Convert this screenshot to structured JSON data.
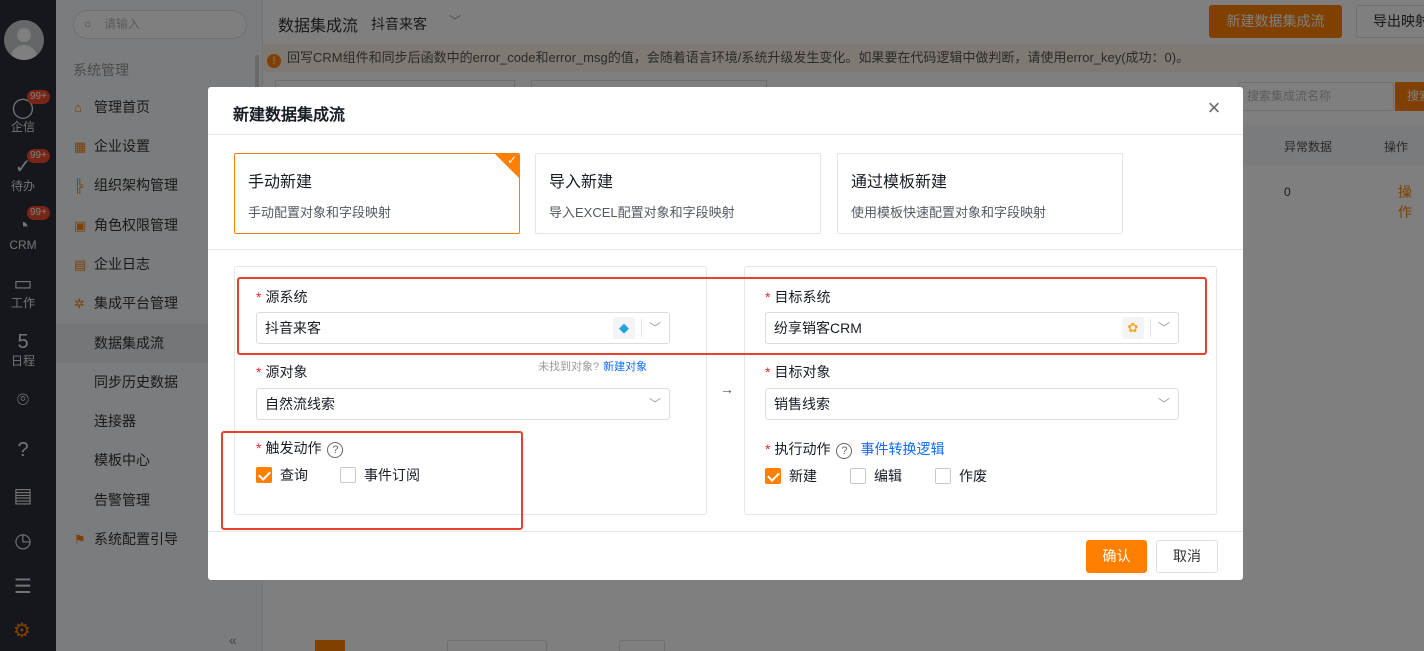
{
  "rail": {
    "items": [
      {
        "icon": "chat-icon",
        "label": "企信",
        "badge": "99+"
      },
      {
        "icon": "todo-icon",
        "label": "待办",
        "badge": "99+"
      },
      {
        "icon": "crm-icon",
        "label": "CRM",
        "badge": "99+"
      },
      {
        "icon": "work-icon",
        "label": "工作"
      },
      {
        "icon": "calendar-icon",
        "label": "日程",
        "glyph": "5"
      }
    ]
  },
  "menu": {
    "search_placeholder": "请输入",
    "group_title": "系统管理",
    "items": [
      {
        "label": "管理首页",
        "icon": "home-icon"
      },
      {
        "label": "企业设置",
        "icon": "enterprise-icon"
      },
      {
        "label": "组织架构管理",
        "icon": "org-icon"
      },
      {
        "label": "角色权限管理",
        "icon": "role-icon"
      },
      {
        "label": "企业日志",
        "icon": "log-icon"
      },
      {
        "label": "集成平台管理",
        "icon": "integration-icon"
      },
      {
        "label": "数据集成流"
      },
      {
        "label": "同步历史数据"
      },
      {
        "label": "连接器"
      },
      {
        "label": "模板中心"
      },
      {
        "label": "告警管理"
      },
      {
        "label": "系统配置引导",
        "icon": "guide-icon"
      }
    ],
    "collapse_glyph": "«"
  },
  "main": {
    "title": "数据集成流",
    "subtitle": "抖音来客",
    "new_flow_button": "新建数据集成流",
    "export_button": "导出映射",
    "notice": "回写CRM组件和同步后函数中的error_code和error_msg的值，会随着语言环境/系统升级发生变化。如果要在代码逻辑中做判断，请使用error_key(成功：0)。",
    "filter_placeholder": "搜索集成流名称",
    "filter_button": "搜索",
    "columns": [
      "异常数据",
      "操作"
    ],
    "row": {
      "abnormal": "0",
      "action": "操作"
    }
  },
  "dialog": {
    "title": "新建数据集成流",
    "modes": [
      {
        "title": "手动新建",
        "desc": "手动配置对象和字段映射",
        "selected": true
      },
      {
        "title": "导入新建",
        "desc": "导入EXCEL配置对象和字段映射",
        "selected": false
      },
      {
        "title": "通过模板新建",
        "desc": "使用模板快速配置对象和字段映射",
        "selected": false
      }
    ],
    "source": {
      "system_label": "源系统",
      "system_value": "抖音来客",
      "object_label": "源对象",
      "object_value": "自然流线索",
      "object_hint": "未找到对象?",
      "object_hint_link": "新建对象",
      "trigger_label": "触发动作",
      "triggers": [
        {
          "label": "查询",
          "checked": true
        },
        {
          "label": "事件订阅",
          "checked": false
        }
      ]
    },
    "target": {
      "system_label": "目标系统",
      "system_value": "纷享销客CRM",
      "object_label": "目标对象",
      "object_value": "销售线索",
      "action_label": "执行动作",
      "action_link": "事件转换逻辑",
      "actions": [
        {
          "label": "新建",
          "checked": true
        },
        {
          "label": "编辑",
          "checked": false
        },
        {
          "label": "作废",
          "checked": false
        }
      ]
    },
    "confirm": "确认",
    "cancel": "取消"
  }
}
